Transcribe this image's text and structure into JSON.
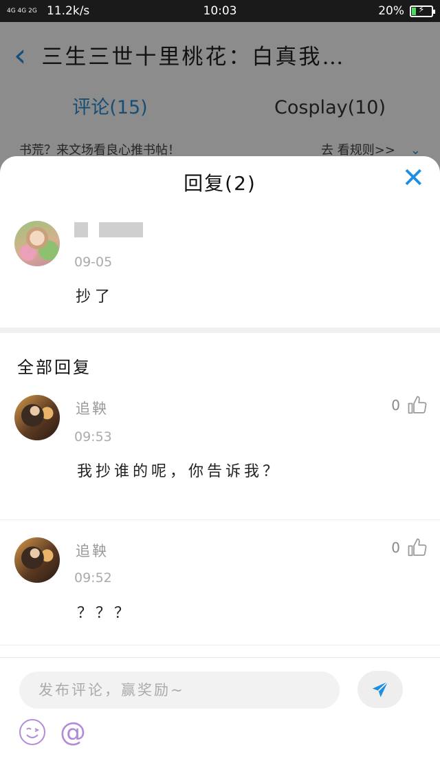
{
  "status_bar": {
    "network": "4G 4G 2G",
    "speed": "11.2k/s",
    "time": "10:03",
    "battery": "20%",
    "battery_level": 0.2
  },
  "background": {
    "title": "三生三世十里桃花：白真我…",
    "tabs": [
      {
        "label": "评论(15)",
        "active": true
      },
      {
        "label": "Cosplay(10)",
        "active": false
      }
    ],
    "notice_left": "书荒？来文场看良心推书帖！",
    "notice_right": "去 看规则>>"
  },
  "sheet": {
    "title": "回复(2)",
    "main_comment": {
      "date": "09-05",
      "text": "抄了"
    },
    "section_title": "全部回复",
    "replies": [
      {
        "name": "追鞅",
        "time": "09:53",
        "text": "我抄谁的呢，你告诉我？",
        "likes": "0"
      },
      {
        "name": "追鞅",
        "time": "09:52",
        "text": "？？？",
        "likes": "0"
      }
    ],
    "input_placeholder": "发布评论，赢奖励~",
    "at_symbol": "@"
  },
  "colors": {
    "accent": "#1e8fe0",
    "emoji": "#b18bd8"
  }
}
